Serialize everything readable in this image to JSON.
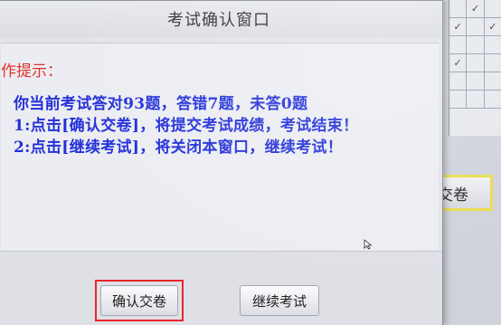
{
  "dialog": {
    "title": "考试确认窗口",
    "hint_label": "作提示：",
    "summary_line": "你当前考试答对93题，答错7题，未答0题",
    "instruction_1": "1:点击[确认交卷]，将提交考试成绩，考试结束！",
    "instruction_2": "2:点击[继续考试]，将关闭本窗口，继续考试！",
    "confirm_button": "确认交卷",
    "continue_button": "继续考试"
  },
  "background": {
    "submit_button": "交卷",
    "grid_marks": [
      "",
      "✓",
      "",
      "✓",
      "",
      "✓",
      "",
      "",
      "",
      "✓",
      "",
      "",
      "",
      "",
      "",
      "",
      "",
      ""
    ]
  },
  "colors": {
    "message_text": "#2230d8",
    "hint_text": "#e0322a",
    "confirm_highlight_border": "#e8262b",
    "submit_highlight_border": "#e9dc4a"
  }
}
